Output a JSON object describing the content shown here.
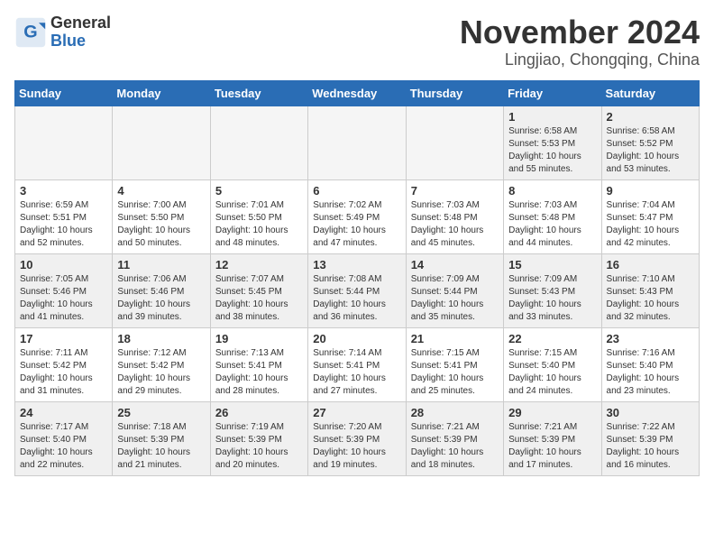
{
  "logo": {
    "general": "General",
    "blue": "Blue"
  },
  "title": "November 2024",
  "location": "Lingjiao, Chongqing, China",
  "weekdays": [
    "Sunday",
    "Monday",
    "Tuesday",
    "Wednesday",
    "Thursday",
    "Friday",
    "Saturday"
  ],
  "weeks": [
    [
      {
        "day": "",
        "info": ""
      },
      {
        "day": "",
        "info": ""
      },
      {
        "day": "",
        "info": ""
      },
      {
        "day": "",
        "info": ""
      },
      {
        "day": "",
        "info": ""
      },
      {
        "day": "1",
        "info": "Sunrise: 6:58 AM\nSunset: 5:53 PM\nDaylight: 10 hours\nand 55 minutes."
      },
      {
        "day": "2",
        "info": "Sunrise: 6:58 AM\nSunset: 5:52 PM\nDaylight: 10 hours\nand 53 minutes."
      }
    ],
    [
      {
        "day": "3",
        "info": "Sunrise: 6:59 AM\nSunset: 5:51 PM\nDaylight: 10 hours\nand 52 minutes."
      },
      {
        "day": "4",
        "info": "Sunrise: 7:00 AM\nSunset: 5:50 PM\nDaylight: 10 hours\nand 50 minutes."
      },
      {
        "day": "5",
        "info": "Sunrise: 7:01 AM\nSunset: 5:50 PM\nDaylight: 10 hours\nand 48 minutes."
      },
      {
        "day": "6",
        "info": "Sunrise: 7:02 AM\nSunset: 5:49 PM\nDaylight: 10 hours\nand 47 minutes."
      },
      {
        "day": "7",
        "info": "Sunrise: 7:03 AM\nSunset: 5:48 PM\nDaylight: 10 hours\nand 45 minutes."
      },
      {
        "day": "8",
        "info": "Sunrise: 7:03 AM\nSunset: 5:48 PM\nDaylight: 10 hours\nand 44 minutes."
      },
      {
        "day": "9",
        "info": "Sunrise: 7:04 AM\nSunset: 5:47 PM\nDaylight: 10 hours\nand 42 minutes."
      }
    ],
    [
      {
        "day": "10",
        "info": "Sunrise: 7:05 AM\nSunset: 5:46 PM\nDaylight: 10 hours\nand 41 minutes."
      },
      {
        "day": "11",
        "info": "Sunrise: 7:06 AM\nSunset: 5:46 PM\nDaylight: 10 hours\nand 39 minutes."
      },
      {
        "day": "12",
        "info": "Sunrise: 7:07 AM\nSunset: 5:45 PM\nDaylight: 10 hours\nand 38 minutes."
      },
      {
        "day": "13",
        "info": "Sunrise: 7:08 AM\nSunset: 5:44 PM\nDaylight: 10 hours\nand 36 minutes."
      },
      {
        "day": "14",
        "info": "Sunrise: 7:09 AM\nSunset: 5:44 PM\nDaylight: 10 hours\nand 35 minutes."
      },
      {
        "day": "15",
        "info": "Sunrise: 7:09 AM\nSunset: 5:43 PM\nDaylight: 10 hours\nand 33 minutes."
      },
      {
        "day": "16",
        "info": "Sunrise: 7:10 AM\nSunset: 5:43 PM\nDaylight: 10 hours\nand 32 minutes."
      }
    ],
    [
      {
        "day": "17",
        "info": "Sunrise: 7:11 AM\nSunset: 5:42 PM\nDaylight: 10 hours\nand 31 minutes."
      },
      {
        "day": "18",
        "info": "Sunrise: 7:12 AM\nSunset: 5:42 PM\nDaylight: 10 hours\nand 29 minutes."
      },
      {
        "day": "19",
        "info": "Sunrise: 7:13 AM\nSunset: 5:41 PM\nDaylight: 10 hours\nand 28 minutes."
      },
      {
        "day": "20",
        "info": "Sunrise: 7:14 AM\nSunset: 5:41 PM\nDaylight: 10 hours\nand 27 minutes."
      },
      {
        "day": "21",
        "info": "Sunrise: 7:15 AM\nSunset: 5:41 PM\nDaylight: 10 hours\nand 25 minutes."
      },
      {
        "day": "22",
        "info": "Sunrise: 7:15 AM\nSunset: 5:40 PM\nDaylight: 10 hours\nand 24 minutes."
      },
      {
        "day": "23",
        "info": "Sunrise: 7:16 AM\nSunset: 5:40 PM\nDaylight: 10 hours\nand 23 minutes."
      }
    ],
    [
      {
        "day": "24",
        "info": "Sunrise: 7:17 AM\nSunset: 5:40 PM\nDaylight: 10 hours\nand 22 minutes."
      },
      {
        "day": "25",
        "info": "Sunrise: 7:18 AM\nSunset: 5:39 PM\nDaylight: 10 hours\nand 21 minutes."
      },
      {
        "day": "26",
        "info": "Sunrise: 7:19 AM\nSunset: 5:39 PM\nDaylight: 10 hours\nand 20 minutes."
      },
      {
        "day": "27",
        "info": "Sunrise: 7:20 AM\nSunset: 5:39 PM\nDaylight: 10 hours\nand 19 minutes."
      },
      {
        "day": "28",
        "info": "Sunrise: 7:21 AM\nSunset: 5:39 PM\nDaylight: 10 hours\nand 18 minutes."
      },
      {
        "day": "29",
        "info": "Sunrise: 7:21 AM\nSunset: 5:39 PM\nDaylight: 10 hours\nand 17 minutes."
      },
      {
        "day": "30",
        "info": "Sunrise: 7:22 AM\nSunset: 5:39 PM\nDaylight: 10 hours\nand 16 minutes."
      }
    ]
  ]
}
